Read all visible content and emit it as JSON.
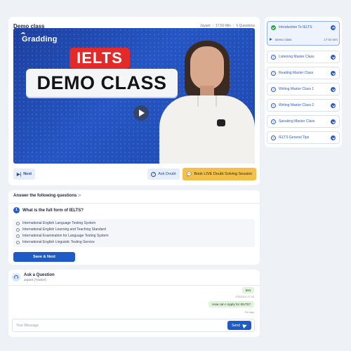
{
  "video": {
    "title": "Demo class",
    "trainer": "Jayant",
    "duration": "17:50 Min",
    "questions": "6 Questions",
    "brand": "Gradding",
    "headline_top": "IELTS",
    "headline_bottom": "DEMO CLASS",
    "next_label": "Next",
    "ask_doubt_label": "Ask Doubt",
    "live_label": "Book LIVE Doubt Solving Session"
  },
  "lessons": {
    "items": [
      {
        "label": "Introduction To IELTS",
        "active": true,
        "completed": true,
        "sub": {
          "label": "Demo class",
          "duration": "17:50 Min"
        }
      },
      {
        "label": "Listening Master Class"
      },
      {
        "label": "Reading Master Class"
      },
      {
        "label": "Writing Master Class 1"
      },
      {
        "label": "Writing Master Class 2"
      },
      {
        "label": "Speaking Master Class"
      },
      {
        "label": "IELTS General Tips"
      }
    ]
  },
  "quiz": {
    "heading": "Answer the following questions :-",
    "number": "1",
    "question": "What is the full form of IELTS?",
    "options": [
      "International English Language Testing System",
      "International English Learning and Teaching Standard",
      "International Examination for Language Testing System",
      "International English Linguistic Testing Service"
    ],
    "save_label": "Save & Next"
  },
  "chat": {
    "title": "Ask a Question",
    "subtitle": "Jayant (Trainer)",
    "messages": [
      {
        "text": "test",
        "time": "2/5/2024 17:33"
      },
      {
        "text": "How can I Apply for IELTS?",
        "time": "1hr ago"
      }
    ],
    "input_placeholder": "Your Message",
    "send_label": "Send"
  },
  "colors": {
    "accent": "#1e5bc6",
    "live_button": "#f3c04a",
    "completed": "#2e9b4a",
    "ielts_red": "#e32a2a"
  }
}
